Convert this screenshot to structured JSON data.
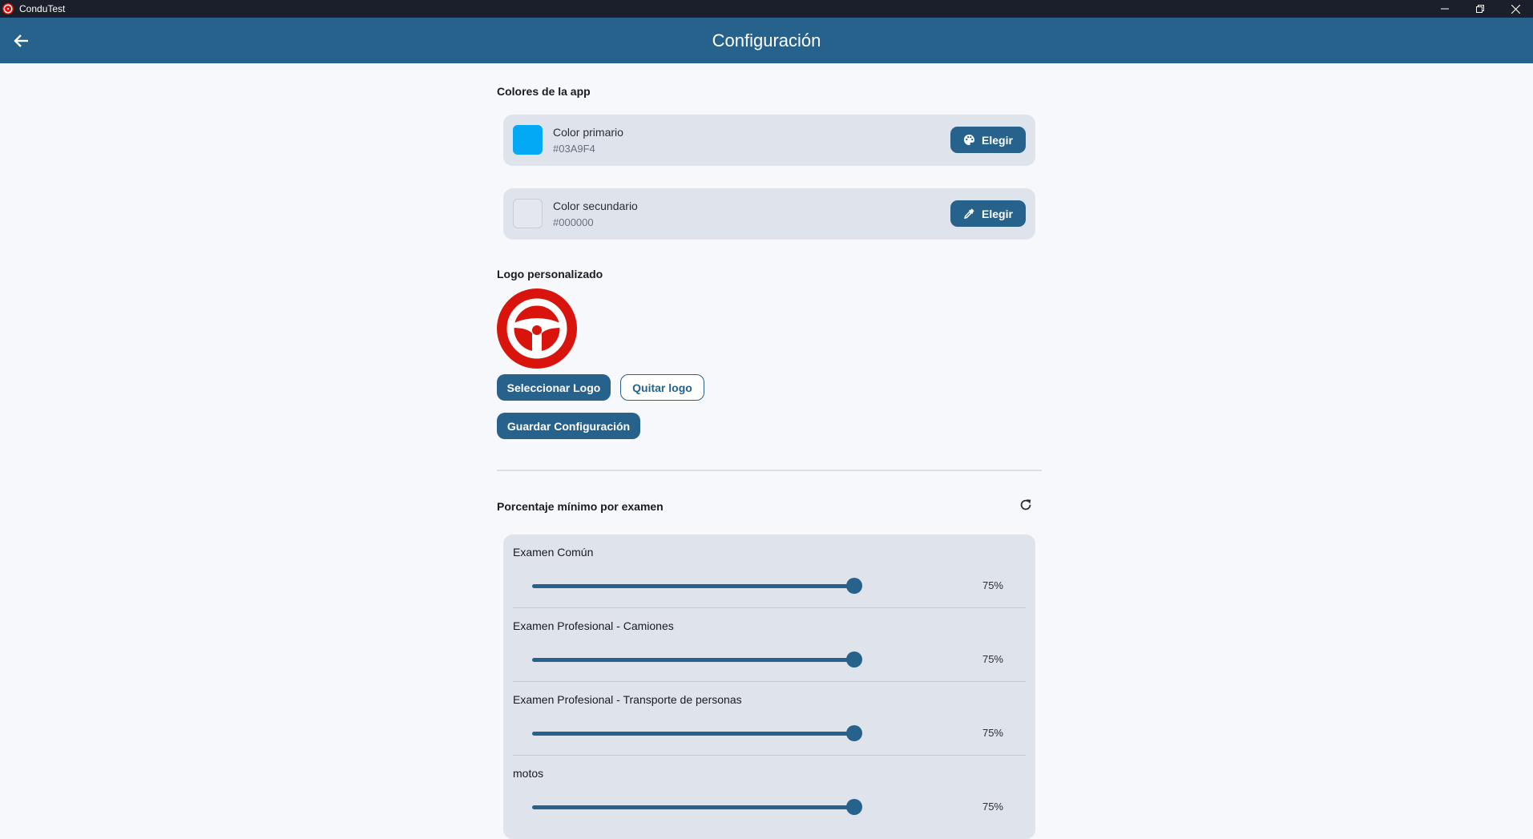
{
  "window": {
    "app_name": "ConduTest",
    "minimize_icon": "minimize-icon",
    "restore_icon": "restore-icon",
    "close_icon": "close-icon"
  },
  "appbar": {
    "title": "Configuración",
    "back_icon": "arrow-left-icon"
  },
  "colors_section": {
    "title": "Colores de la app",
    "primary": {
      "label": "Color primario",
      "hex": "#03A9F4",
      "button_label": "Elegir",
      "button_icon": "palette-icon"
    },
    "secondary": {
      "label": "Color secundario",
      "hex": "#000000",
      "button_label": "Elegir",
      "button_icon": "eyedropper-icon"
    }
  },
  "logo_section": {
    "title": "Logo personalizado",
    "logo_icon": "steering-wheel-icon",
    "select_label": "Seleccionar Logo",
    "remove_label": "Quitar logo"
  },
  "save_label": "Guardar Configuración",
  "exams_section": {
    "title": "Porcentaje mínimo por examen",
    "reset_icon": "refresh-icon",
    "items": [
      {
        "label": "Examen Común",
        "value": 75,
        "display": "75%"
      },
      {
        "label": "Examen Profesional - Camiones",
        "value": 75,
        "display": "75%"
      },
      {
        "label": "Examen Profesional - Transporte de personas",
        "value": 75,
        "display": "75%"
      },
      {
        "label": "motos",
        "value": 75,
        "display": "75%"
      }
    ]
  },
  "colors": {
    "accent": "#26628b",
    "logo_red": "#d8140c",
    "titlebar": "#1b1e2b"
  }
}
